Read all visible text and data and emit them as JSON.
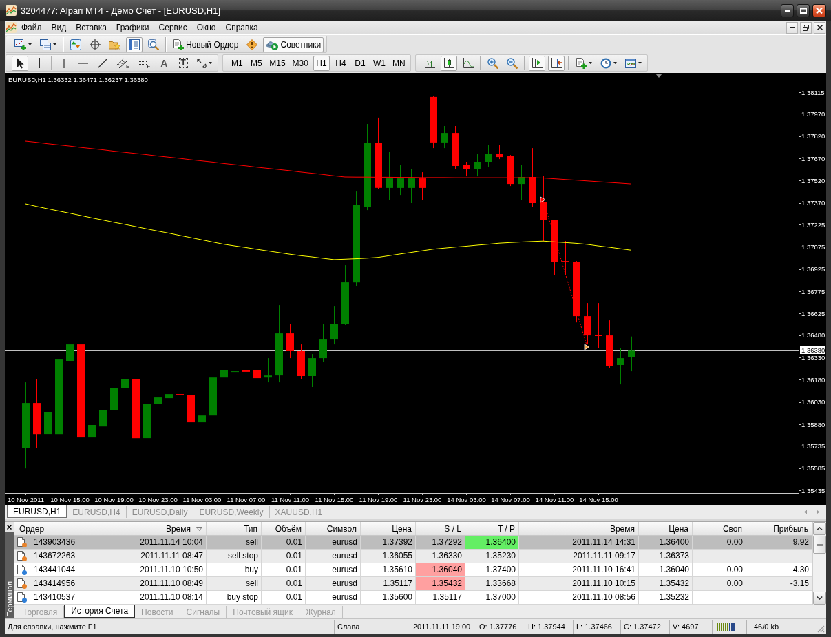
{
  "window": {
    "title": "3204477: Alpari MT4 - Демо Счет - [EURUSD,H1]"
  },
  "menu": [
    "Файл",
    "Вид",
    "Вставка",
    "Графики",
    "Сервис",
    "Окно",
    "Справка"
  ],
  "toolbar_rows": [
    [
      {
        "groups": [
          [
            {
              "kind": "new-chart",
              "selected": false
            },
            {
              "kind": "profiles",
              "selected": false
            }
          ],
          [
            {
              "kind": "market-watch",
              "selected": false
            },
            {
              "kind": "data-window",
              "selected": false
            },
            {
              "kind": "navigator",
              "selected": false
            },
            {
              "kind": "terminal",
              "selected": true
            },
            {
              "kind": "tester",
              "selected": false
            }
          ],
          [
            {
              "kind": "new-order",
              "label": "Новый Ордер",
              "selected": false
            },
            {
              "kind": "editor",
              "selected": false
            },
            {
              "kind": "experts",
              "label": "Советники",
              "selected": true
            }
          ]
        ]
      }
    ],
    [
      {
        "groups": [
          [
            {
              "kind": "cursor",
              "selected": true
            },
            {
              "kind": "crosshair",
              "selected": false
            }
          ],
          [
            {
              "kind": "vline",
              "selected": false
            },
            {
              "kind": "hline",
              "selected": false
            },
            {
              "kind": "trendline",
              "selected": false
            },
            {
              "kind": "channel",
              "label": "E",
              "selected": false
            },
            {
              "kind": "fibo",
              "label": "F",
              "selected": false
            },
            {
              "kind": "text",
              "label": "A",
              "selected": false
            },
            {
              "kind": "text-label",
              "label": "T",
              "selected": false
            },
            {
              "kind": "arrows",
              "selected": false
            }
          ]
        ]
      },
      {
        "groups": [
          [
            {
              "kind": "timeframe",
              "label": "M1",
              "selected": false
            },
            {
              "kind": "timeframe",
              "label": "M5",
              "selected": false
            },
            {
              "kind": "timeframe",
              "label": "M15",
              "selected": false
            },
            {
              "kind": "timeframe",
              "label": "M30",
              "selected": false
            },
            {
              "kind": "timeframe",
              "label": "H1",
              "selected": true
            },
            {
              "kind": "timeframe",
              "label": "H4",
              "selected": false
            },
            {
              "kind": "timeframe",
              "label": "D1",
              "selected": false
            },
            {
              "kind": "timeframe",
              "label": "W1",
              "selected": false
            },
            {
              "kind": "timeframe",
              "label": "MN",
              "selected": false
            }
          ]
        ]
      },
      {
        "groups": [
          [
            {
              "kind": "bar-chart",
              "selected": false
            },
            {
              "kind": "candle-chart",
              "selected": true
            },
            {
              "kind": "line-chart",
              "selected": false
            }
          ],
          [
            {
              "kind": "zoom-in",
              "selected": false
            },
            {
              "kind": "zoom-out",
              "selected": false
            }
          ],
          [
            {
              "kind": "autoscroll",
              "selected": true
            },
            {
              "kind": "chart-shift",
              "selected": true
            }
          ],
          [
            {
              "kind": "indicators",
              "selected": false
            },
            {
              "kind": "periods",
              "selected": false
            },
            {
              "kind": "templates",
              "selected": false
            }
          ]
        ]
      }
    ]
  ],
  "chart": {
    "chart_data": [
      {
        "type": "candlestick",
        "title": "EURUSD,H1 1.36332 1.36471 1.36237 1.36380",
        "categories": [
          "10 Nov 2011",
          null,
          null,
          null,
          "10 Nov 15:00",
          null,
          null,
          null,
          "10 Nov 19:00",
          null,
          null,
          null,
          "10 Nov 23:00",
          null,
          null,
          null,
          "11 Nov 03:00",
          null,
          null,
          null,
          "11 Nov 07:00",
          null,
          null,
          null,
          "11 Nov 11:00",
          null,
          null,
          null,
          "11 Nov 15:00",
          null,
          null,
          null,
          "11 Nov 19:00",
          null,
          null,
          null,
          "11 Nov 23:00",
          null,
          null,
          null,
          "14 Nov 03:00",
          null,
          null,
          null,
          "14 Nov 07:00",
          null,
          null,
          null,
          "14 Nov 11:00",
          null,
          null,
          null,
          "14 Nov 15:00",
          null,
          null,
          null
        ],
        "ohlc": [
          [
            1.35723,
            1.36163,
            1.35583,
            1.36024
          ],
          [
            1.36024,
            1.36186,
            1.35723,
            1.35815
          ],
          [
            1.35815,
            1.36047,
            1.35639,
            1.35964
          ],
          [
            1.35815,
            1.36441,
            1.35699,
            1.36316
          ],
          [
            1.36307,
            1.3652,
            1.36233,
            1.36418
          ],
          [
            1.36418,
            1.36441,
            1.35676,
            1.35792
          ],
          [
            1.35792,
            1.36001,
            1.35491,
            1.35876
          ],
          [
            1.35866,
            1.36093,
            1.35639,
            1.35978
          ],
          [
            1.35978,
            1.36233,
            1.35769,
            1.36126
          ],
          [
            1.36126,
            1.36335,
            1.35954,
            1.36182
          ],
          [
            1.36182,
            1.36233,
            1.35676,
            1.35787
          ],
          [
            1.35787,
            1.36093,
            1.35769,
            1.36019
          ],
          [
            1.36015,
            1.3614,
            1.35954,
            1.36061
          ],
          [
            1.36056,
            1.36163,
            1.36001,
            1.36084
          ],
          [
            1.36084,
            1.36186,
            1.36047,
            1.36075
          ],
          [
            1.3608,
            1.36126,
            1.35862,
            1.35894
          ],
          [
            1.35894,
            1.36001,
            1.35769,
            1.3594
          ],
          [
            1.3594,
            1.36256,
            1.35908,
            1.36195
          ],
          [
            1.36195,
            1.36302,
            1.36172,
            1.36246
          ],
          [
            1.36233,
            1.36302,
            1.36209,
            1.36237
          ],
          [
            1.36242,
            1.36297,
            1.36209,
            1.36233
          ],
          [
            1.36246,
            1.36302,
            1.3614,
            1.36191
          ],
          [
            1.36195,
            1.36325,
            1.36163,
            1.36209
          ],
          [
            1.36209,
            1.36682,
            1.36163,
            1.36492
          ],
          [
            1.36492,
            1.36557,
            1.36325,
            1.36372
          ],
          [
            1.36372,
            1.36418,
            1.36186,
            1.36205
          ],
          [
            1.36205,
            1.36353,
            1.36131,
            1.36325
          ],
          [
            1.36325,
            1.36557,
            1.36302,
            1.36455
          ],
          [
            1.36455,
            1.36673,
            1.36418,
            1.36557
          ],
          [
            1.36557,
            1.36951,
            1.36548,
            1.36835
          ],
          [
            1.36835,
            1.37447,
            1.36812,
            1.37355
          ],
          [
            1.37345,
            1.37902,
            1.37322,
            1.37776
          ],
          [
            1.37776,
            1.37944,
            1.37466,
            1.37472
          ],
          [
            1.37471,
            1.37716,
            1.37392,
            1.37535
          ],
          [
            1.37471,
            1.37624,
            1.37424,
            1.37535
          ],
          [
            1.37471,
            1.37596,
            1.37369,
            1.37535
          ],
          [
            1.37535,
            1.37577,
            1.37392,
            1.37471
          ],
          [
            1.38083,
            1.38087,
            1.37739,
            1.37777
          ],
          [
            1.37777,
            1.37888,
            1.37739,
            1.37841
          ],
          [
            1.37841,
            1.37888,
            1.376,
            1.37619
          ],
          [
            1.37624,
            1.37647,
            1.37549,
            1.376
          ],
          [
            1.376,
            1.37698,
            1.37549,
            1.37647
          ],
          [
            1.37647,
            1.37763,
            1.37614,
            1.37698
          ],
          [
            1.37698,
            1.37763,
            1.37665,
            1.37679
          ],
          [
            1.37684,
            1.37693,
            1.37484,
            1.37498
          ],
          [
            1.37498,
            1.37624,
            1.37392,
            1.37545
          ],
          [
            1.37545,
            1.37739,
            1.37345,
            1.37369
          ],
          [
            1.37378,
            1.37554,
            1.37114,
            1.37253
          ],
          [
            1.37253,
            1.37257,
            1.36882,
            1.36974
          ],
          [
            1.36979,
            1.37114,
            1.36882,
            1.3697
          ],
          [
            1.36974,
            1.36979,
            1.36566,
            1.36608
          ],
          [
            1.36608,
            1.36696,
            1.36418,
            1.36478
          ],
          [
            1.36483,
            1.36696,
            1.36395,
            1.36474
          ],
          [
            1.36478,
            1.3658,
            1.36256,
            1.36274
          ],
          [
            1.36279,
            1.36395,
            1.36149,
            1.36325
          ],
          [
            1.36332,
            1.36471,
            1.36237,
            1.3638
          ]
        ],
        "series": [
          {
            "type": "line",
            "color": "#ff0000",
            "values": [
              1.37786,
              1.37778,
              1.37769,
              1.37761,
              1.37753,
              1.37744,
              1.37736,
              1.37728,
              1.37719,
              1.37711,
              1.37703,
              1.37695,
              1.37686,
              1.37678,
              1.3767,
              1.37661,
              1.37653,
              1.37645,
              1.37636,
              1.37628,
              1.3762,
              1.37611,
              1.37603,
              1.37595,
              1.37587,
              1.37578,
              1.3757,
              1.37562,
              1.37553,
              1.37545,
              1.37544,
              1.37544,
              1.37543,
              1.37543,
              1.37542,
              1.37542,
              1.37541,
              1.37541,
              1.37541,
              1.3754,
              1.3754,
              1.3754,
              1.3754,
              1.3754,
              1.3754,
              1.3754,
              1.3754,
              1.37538,
              1.37533,
              1.37528,
              1.37523,
              1.37518,
              1.37513,
              1.37508,
              1.37503,
              1.37498
            ]
          },
          {
            "type": "line",
            "color": "#ffff00",
            "values": [
              1.37364,
              1.37347,
              1.37331,
              1.37316,
              1.37301,
              1.37286,
              1.3727,
              1.37255,
              1.3724,
              1.37226,
              1.37211,
              1.37196,
              1.37181,
              1.37167,
              1.37152,
              1.37137,
              1.37122,
              1.37107,
              1.37092,
              1.37081,
              1.3707,
              1.37058,
              1.37047,
              1.37036,
              1.37025,
              1.37015,
              1.37007,
              1.36998,
              1.36989,
              1.36992,
              1.36995,
              1.36999,
              1.37004,
              1.37015,
              1.37026,
              1.37037,
              1.37048,
              1.37059,
              1.37066,
              1.37073,
              1.37079,
              1.37086,
              1.37092,
              1.37099,
              1.37103,
              1.37107,
              1.3711,
              1.37113,
              1.37108,
              1.37103,
              1.37098,
              1.37091,
              1.37081,
              1.37072,
              1.37062,
              1.37052
            ]
          },
          {
            "type": "line",
            "color": "#ff0000",
            "line_style": "dotted",
            "values": [
              null,
              null,
              null,
              null,
              null,
              null,
              null,
              null,
              null,
              null,
              null,
              null,
              null,
              null,
              null,
              null,
              null,
              null,
              null,
              null,
              null,
              null,
              null,
              null,
              null,
              null,
              null,
              null,
              null,
              null,
              null,
              null,
              null,
              null,
              null,
              null,
              null,
              null,
              null,
              null,
              null,
              null,
              null,
              null,
              null,
              null,
              null,
              1.37392,
              1.37144,
              1.36896,
              1.36648,
              1.364,
              null,
              null,
              null,
              null
            ]
          },
          {
            "type": "scatter",
            "marker": "triangle",
            "color": "#ff0000",
            "values": [
              null,
              null,
              null,
              null,
              null,
              null,
              null,
              null,
              null,
              null,
              null,
              null,
              null,
              null,
              null,
              null,
              null,
              null,
              null,
              null,
              null,
              null,
              null,
              null,
              null,
              null,
              null,
              null,
              null,
              null,
              null,
              null,
              null,
              null,
              null,
              null,
              null,
              null,
              null,
              null,
              null,
              null,
              null,
              null,
              null,
              null,
              null,
              1.37392,
              null,
              null,
              null,
              null,
              null,
              null,
              null,
              null
            ]
          },
          {
            "type": "scatter",
            "marker": "triangle",
            "color": "#f0a848",
            "values": [
              null,
              null,
              null,
              null,
              null,
              null,
              null,
              null,
              null,
              null,
              null,
              null,
              null,
              null,
              null,
              null,
              null,
              null,
              null,
              null,
              null,
              null,
              null,
              null,
              null,
              null,
              null,
              null,
              null,
              null,
              null,
              null,
              null,
              null,
              null,
              null,
              null,
              null,
              null,
              null,
              null,
              null,
              null,
              null,
              null,
              null,
              null,
              null,
              null,
              null,
              null,
              1.364,
              null,
              null,
              null,
              null
            ]
          }
        ],
        "ylim": [
          1.35417,
          1.38245
        ],
        "yticks": [
          {
            "value": 1.38115,
            "label": "1.38115"
          },
          {
            "value": 1.3797,
            "label": "1.37970"
          },
          {
            "value": 1.3782,
            "label": "1.37820"
          },
          {
            "value": 1.3767,
            "label": "1.37670"
          },
          {
            "value": 1.3752,
            "label": "1.37520"
          },
          {
            "value": 1.3737,
            "label": "1.37370"
          },
          {
            "value": 1.37225,
            "label": "1.37225"
          },
          {
            "value": 1.37075,
            "label": "1.37075"
          },
          {
            "value": 1.36925,
            "label": "1.36925"
          },
          {
            "value": 1.36775,
            "label": "1.36775"
          },
          {
            "value": 1.36625,
            "label": "1.36625"
          },
          {
            "value": 1.3648,
            "label": "1.36480"
          },
          {
            "value": 1.3633,
            "label": "1.36330"
          },
          {
            "value": 1.3618,
            "label": "1.36180"
          },
          {
            "value": 1.3603,
            "label": "1.36030"
          },
          {
            "value": 1.3588,
            "label": "1.35880"
          },
          {
            "value": 1.35735,
            "label": "1.35735"
          },
          {
            "value": 1.35585,
            "label": "1.35585"
          },
          {
            "value": 1.35435,
            "label": "1.35435"
          }
        ],
        "ref_lines": [
          {
            "axis": "y",
            "value": 1.3638,
            "label": "1.36380",
            "color": "#c0c0c0"
          }
        ]
      }
    ],
    "tabs": [
      {
        "label": "EURUSD,H1",
        "selected": true
      },
      {
        "label": "EURUSD,H4",
        "selected": false
      },
      {
        "label": "EURUSD,Daily",
        "selected": false
      },
      {
        "label": "EURUSD,Weekly",
        "selected": false
      },
      {
        "label": "XAUUSD,H1",
        "selected": false
      }
    ]
  },
  "terminal": {
    "title": "Терминал",
    "columns": [
      {
        "label": "Ордер",
        "sorted": false
      },
      {
        "label": "Время",
        "sorted": true
      },
      {
        "label": "Тип",
        "sorted": false
      },
      {
        "label": "Объём",
        "sorted": false
      },
      {
        "label": "Символ",
        "sorted": false
      },
      {
        "label": "Цена",
        "sorted": false
      },
      {
        "label": "S / L",
        "sorted": false
      },
      {
        "label": "T / P",
        "sorted": false
      },
      {
        "label": "Время",
        "sorted": false
      },
      {
        "label": "Цена",
        "sorted": false
      },
      {
        "label": "Своп",
        "sorted": false
      },
      {
        "label": "Прибыль",
        "sorted": false
      }
    ],
    "rows": [
      {
        "selected": true,
        "color": "#e8822a",
        "sl_hit": false,
        "tp_hit": true,
        "cells": [
          "143903436",
          "2011.11.14 10:04",
          "sell",
          "0.01",
          "eurusd",
          "1.37392",
          "1.37292",
          "1.36400",
          "2011.11.14 14:31",
          "1.36400",
          "0.00",
          "9.92"
        ]
      },
      {
        "selected": false,
        "color": "#e8822a",
        "sl_hit": false,
        "tp_hit": false,
        "cells": [
          "143672263",
          "2011.11.11 08:47",
          "sell stop",
          "0.01",
          "eurusd",
          "1.36055",
          "1.36330",
          "1.35230",
          "2011.11.11 09:17",
          "1.36373"
        ]
      },
      {
        "selected": false,
        "color": "#2f7fd8",
        "sl_hit": true,
        "tp_hit": false,
        "cells": [
          "143441044",
          "2011.11.10 10:50",
          "buy",
          "0.01",
          "eurusd",
          "1.35610",
          "1.36040",
          "1.37400",
          "2011.11.10 16:41",
          "1.36040",
          "0.00",
          "4.30"
        ]
      },
      {
        "selected": false,
        "color": "#e8822a",
        "sl_hit": true,
        "tp_hit": false,
        "cells": [
          "143414956",
          "2011.11.10 08:49",
          "sell",
          "0.01",
          "eurusd",
          "1.35117",
          "1.35432",
          "1.33668",
          "2011.11.10 10:15",
          "1.35432",
          "0.00",
          "-3.15"
        ]
      },
      {
        "selected": false,
        "color": "#2f7fd8",
        "sl_hit": false,
        "tp_hit": false,
        "cells": [
          "143410537",
          "2011.11.10 08:14",
          "buy stop",
          "0.01",
          "eurusd",
          "1.35600",
          "1.35117",
          "1.37000",
          "2011.11.10 08:56",
          "1.35232"
        ]
      }
    ],
    "tabs": [
      {
        "label": "Торговля",
        "selected": false
      },
      {
        "label": "История Счета",
        "selected": true
      },
      {
        "label": "Новости",
        "selected": false
      },
      {
        "label": "Сигналы",
        "selected": false
      },
      {
        "label": "Почтовый ящик",
        "selected": false
      },
      {
        "label": "Журнал",
        "selected": false
      }
    ]
  },
  "status_bar": {
    "help": "Для справки, нажмите F1",
    "profile": "Слава",
    "bar_time": "2011.11.11 19:00",
    "open": "O: 1.37776",
    "high": "H: 1.37944",
    "low": "L: 1.37466",
    "close": "C: 1.37472",
    "volume": "V: 4697",
    "traffic": "46/0 kb"
  }
}
